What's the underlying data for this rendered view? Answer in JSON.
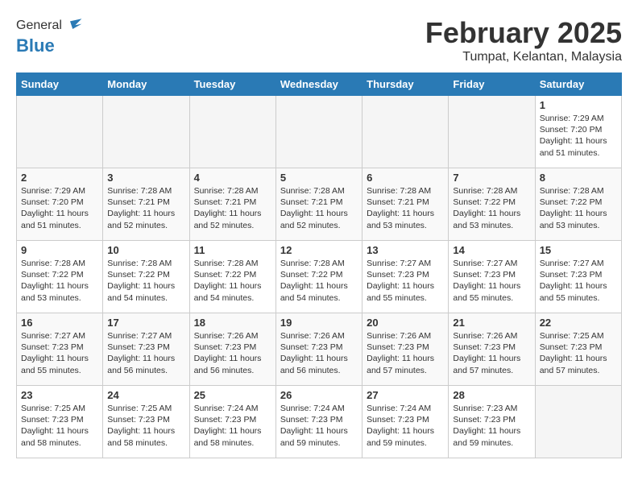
{
  "header": {
    "logo_line1": "General",
    "logo_line2": "Blue",
    "month": "February 2025",
    "location": "Tumpat, Kelantan, Malaysia"
  },
  "weekdays": [
    "Sunday",
    "Monday",
    "Tuesday",
    "Wednesday",
    "Thursday",
    "Friday",
    "Saturday"
  ],
  "weeks": [
    [
      {
        "day": "",
        "info": ""
      },
      {
        "day": "",
        "info": ""
      },
      {
        "day": "",
        "info": ""
      },
      {
        "day": "",
        "info": ""
      },
      {
        "day": "",
        "info": ""
      },
      {
        "day": "",
        "info": ""
      },
      {
        "day": "1",
        "info": "Sunrise: 7:29 AM\nSunset: 7:20 PM\nDaylight: 11 hours\nand 51 minutes."
      }
    ],
    [
      {
        "day": "2",
        "info": "Sunrise: 7:29 AM\nSunset: 7:20 PM\nDaylight: 11 hours\nand 51 minutes."
      },
      {
        "day": "3",
        "info": "Sunrise: 7:28 AM\nSunset: 7:21 PM\nDaylight: 11 hours\nand 52 minutes."
      },
      {
        "day": "4",
        "info": "Sunrise: 7:28 AM\nSunset: 7:21 PM\nDaylight: 11 hours\nand 52 minutes."
      },
      {
        "day": "5",
        "info": "Sunrise: 7:28 AM\nSunset: 7:21 PM\nDaylight: 11 hours\nand 52 minutes."
      },
      {
        "day": "6",
        "info": "Sunrise: 7:28 AM\nSunset: 7:21 PM\nDaylight: 11 hours\nand 53 minutes."
      },
      {
        "day": "7",
        "info": "Sunrise: 7:28 AM\nSunset: 7:22 PM\nDaylight: 11 hours\nand 53 minutes."
      },
      {
        "day": "8",
        "info": "Sunrise: 7:28 AM\nSunset: 7:22 PM\nDaylight: 11 hours\nand 53 minutes."
      }
    ],
    [
      {
        "day": "9",
        "info": "Sunrise: 7:28 AM\nSunset: 7:22 PM\nDaylight: 11 hours\nand 53 minutes."
      },
      {
        "day": "10",
        "info": "Sunrise: 7:28 AM\nSunset: 7:22 PM\nDaylight: 11 hours\nand 54 minutes."
      },
      {
        "day": "11",
        "info": "Sunrise: 7:28 AM\nSunset: 7:22 PM\nDaylight: 11 hours\nand 54 minutes."
      },
      {
        "day": "12",
        "info": "Sunrise: 7:28 AM\nSunset: 7:22 PM\nDaylight: 11 hours\nand 54 minutes."
      },
      {
        "day": "13",
        "info": "Sunrise: 7:27 AM\nSunset: 7:23 PM\nDaylight: 11 hours\nand 55 minutes."
      },
      {
        "day": "14",
        "info": "Sunrise: 7:27 AM\nSunset: 7:23 PM\nDaylight: 11 hours\nand 55 minutes."
      },
      {
        "day": "15",
        "info": "Sunrise: 7:27 AM\nSunset: 7:23 PM\nDaylight: 11 hours\nand 55 minutes."
      }
    ],
    [
      {
        "day": "16",
        "info": "Sunrise: 7:27 AM\nSunset: 7:23 PM\nDaylight: 11 hours\nand 55 minutes."
      },
      {
        "day": "17",
        "info": "Sunrise: 7:27 AM\nSunset: 7:23 PM\nDaylight: 11 hours\nand 56 minutes."
      },
      {
        "day": "18",
        "info": "Sunrise: 7:26 AM\nSunset: 7:23 PM\nDaylight: 11 hours\nand 56 minutes."
      },
      {
        "day": "19",
        "info": "Sunrise: 7:26 AM\nSunset: 7:23 PM\nDaylight: 11 hours\nand 56 minutes."
      },
      {
        "day": "20",
        "info": "Sunrise: 7:26 AM\nSunset: 7:23 PM\nDaylight: 11 hours\nand 57 minutes."
      },
      {
        "day": "21",
        "info": "Sunrise: 7:26 AM\nSunset: 7:23 PM\nDaylight: 11 hours\nand 57 minutes."
      },
      {
        "day": "22",
        "info": "Sunrise: 7:25 AM\nSunset: 7:23 PM\nDaylight: 11 hours\nand 57 minutes."
      }
    ],
    [
      {
        "day": "23",
        "info": "Sunrise: 7:25 AM\nSunset: 7:23 PM\nDaylight: 11 hours\nand 58 minutes."
      },
      {
        "day": "24",
        "info": "Sunrise: 7:25 AM\nSunset: 7:23 PM\nDaylight: 11 hours\nand 58 minutes."
      },
      {
        "day": "25",
        "info": "Sunrise: 7:24 AM\nSunset: 7:23 PM\nDaylight: 11 hours\nand 58 minutes."
      },
      {
        "day": "26",
        "info": "Sunrise: 7:24 AM\nSunset: 7:23 PM\nDaylight: 11 hours\nand 59 minutes."
      },
      {
        "day": "27",
        "info": "Sunrise: 7:24 AM\nSunset: 7:23 PM\nDaylight: 11 hours\nand 59 minutes."
      },
      {
        "day": "28",
        "info": "Sunrise: 7:23 AM\nSunset: 7:23 PM\nDaylight: 11 hours\nand 59 minutes."
      },
      {
        "day": "",
        "info": ""
      }
    ]
  ]
}
